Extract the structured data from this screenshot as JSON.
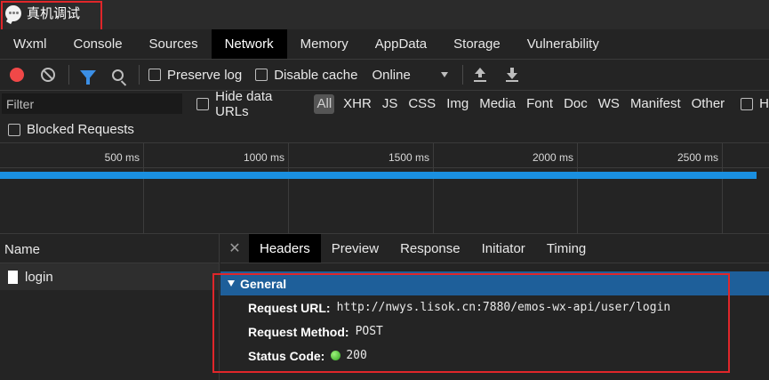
{
  "window": {
    "title": "真机调试"
  },
  "tabs": [
    {
      "label": "Wxml"
    },
    {
      "label": "Console"
    },
    {
      "label": "Sources"
    },
    {
      "label": "Network",
      "active": true
    },
    {
      "label": "Memory"
    },
    {
      "label": "AppData"
    },
    {
      "label": "Storage"
    },
    {
      "label": "Vulnerability"
    }
  ],
  "toolbar": {
    "preserve_log": "Preserve log",
    "disable_cache": "Disable cache",
    "throttling": "Online",
    "record_color": "#f04848"
  },
  "filter": {
    "placeholder": "Filter",
    "hide_data_urls": "Hide data URLs",
    "types": [
      "All",
      "XHR",
      "JS",
      "CSS",
      "Img",
      "Media",
      "Font",
      "Doc",
      "WS",
      "Manifest",
      "Other"
    ],
    "cut_off_label": "H"
  },
  "blocked_requests": "Blocked Requests",
  "timeline": {
    "ticks": [
      "500 ms",
      "1000 ms",
      "1500 ms",
      "2000 ms",
      "2500 ms"
    ],
    "bar_color": "#1a8fe0"
  },
  "requests": {
    "header": "Name",
    "items": [
      {
        "name": "login"
      }
    ]
  },
  "details": {
    "tabs": [
      "Headers",
      "Preview",
      "Response",
      "Initiator",
      "Timing"
    ],
    "active_tab": "Headers",
    "general": {
      "title": "General",
      "request_url_label": "Request URL:",
      "request_url": "http://nwys.lisok.cn:7880/emos-wx-api/user/login",
      "request_method_label": "Request Method:",
      "request_method": "POST",
      "status_code_label": "Status Code:",
      "status_code": "200"
    }
  }
}
